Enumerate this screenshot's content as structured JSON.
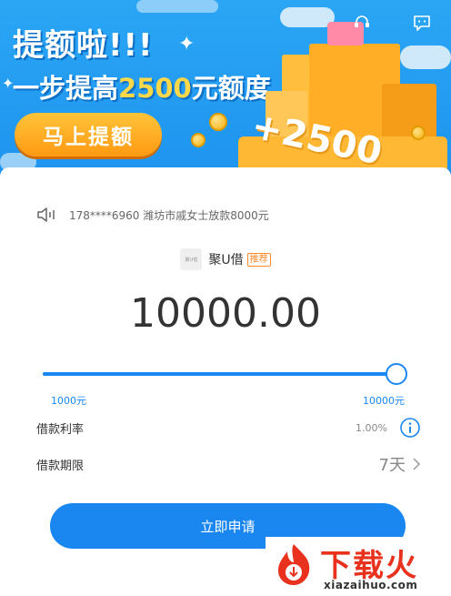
{
  "banner": {
    "title": "提额啦!!!",
    "subtitle_pre": "一步提高",
    "subtitle_amount": "2500",
    "subtitle_post": "元额度",
    "button_label": "马上提额",
    "plus_label": "+2500"
  },
  "notice": {
    "text": "178****6960 潍坊市戚女士放款8000元"
  },
  "product": {
    "logo_text": "聚U借",
    "name": "聚U借",
    "badge": "推荐"
  },
  "loan": {
    "amount": "10000.00",
    "min_label": "1000元",
    "max_label": "10000元",
    "slider_fraction": 1.0
  },
  "rate": {
    "label": "借款利率",
    "value": "1.00%"
  },
  "term": {
    "label": "借款期限",
    "value": "7天"
  },
  "apply": {
    "label": "立即申请"
  },
  "watermark": {
    "brand": "下载火",
    "url": "xiazaihuo.com"
  },
  "colors": {
    "primary": "#1a86f0",
    "accent": "#ffd84a",
    "badge": "#ff8a2a"
  }
}
